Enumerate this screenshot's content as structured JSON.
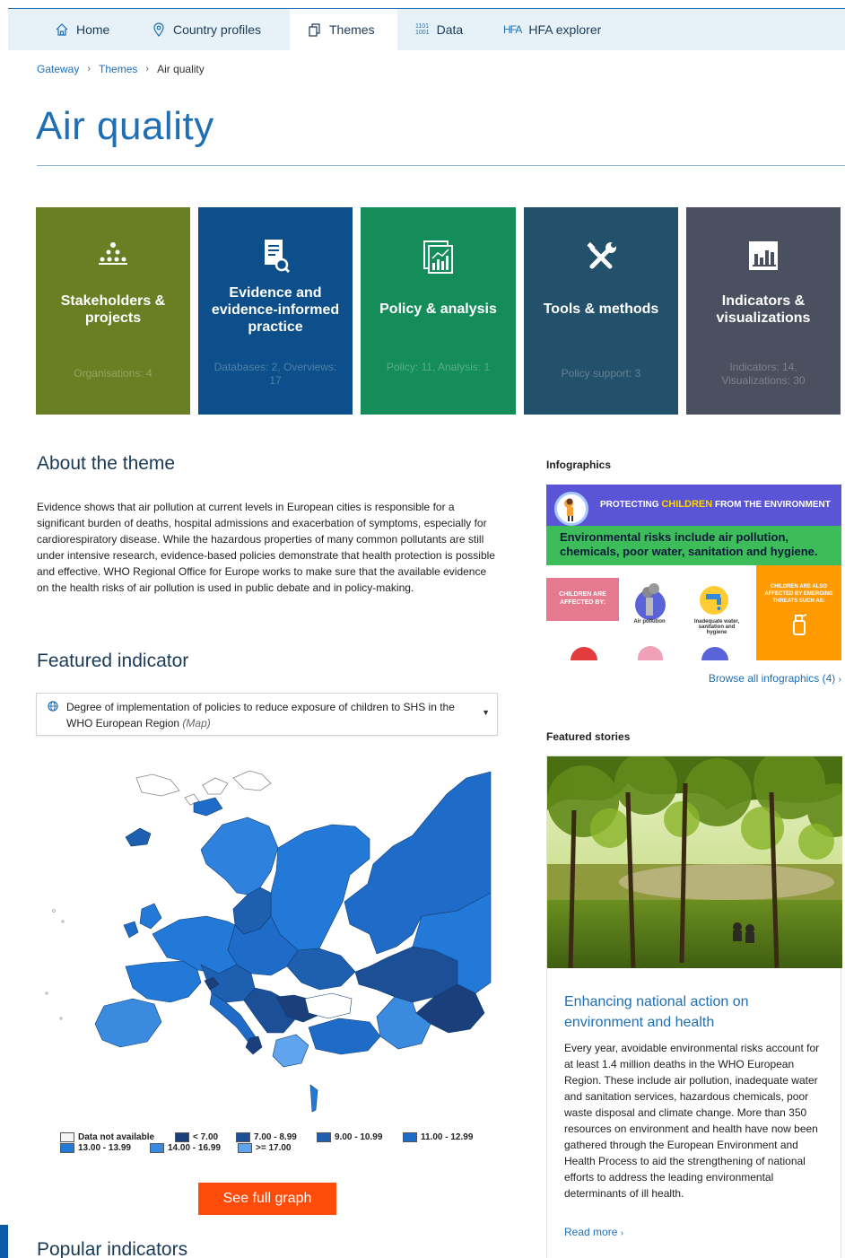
{
  "nav": {
    "items": [
      {
        "label": "Home",
        "icon": "home-icon"
      },
      {
        "label": "Country profiles",
        "icon": "location-pin-icon"
      },
      {
        "label": "Themes",
        "icon": "copy-pages-icon",
        "active": true
      },
      {
        "label": "Data",
        "icon": "binary-data-icon",
        "icon_text": "1101\n1001"
      },
      {
        "label": "HFA explorer",
        "icon": "hfa-icon",
        "icon_text": "HFA"
      }
    ]
  },
  "breadcrumb": [
    "Gateway",
    "Themes",
    "Air quality"
  ],
  "page_title": "Air quality",
  "tiles": [
    {
      "label": "Stakeholders & projects",
      "sub": "Organisations: 4",
      "icon": "people-network-icon",
      "color": "#6a7f24"
    },
    {
      "label": "Evidence and evidence-informed practice",
      "sub": "Databases: 2, Overviews: 17",
      "icon": "document-search-icon",
      "color": "#0c4f8a"
    },
    {
      "label": "Policy & analysis",
      "sub": "Policy: 11, Analysis: 1",
      "icon": "chart-report-icon",
      "color": "#158d5a"
    },
    {
      "label": "Tools & methods",
      "sub": "Policy support: 3",
      "icon": "tools-icon",
      "color": "#23516b"
    },
    {
      "label": "Indicators & visualizations",
      "sub": "Indicators: 14, Visualizations: 30",
      "icon": "bar-chart-icon",
      "color": "#4a5060"
    }
  ],
  "about": {
    "heading": "About the theme",
    "text": "Evidence shows that air pollution at current levels in European cities is responsible for a significant burden of deaths, hospital admissions and exacerbation of symptoms, especially for cardiorespiratory disease. While the hazardous properties of many common pollutants are still under intensive research, evidence-based policies demonstrate that health protection is possible and effective. WHO Regional Office for Europe works to make sure that the available evidence on the health risks of air pollution is used in public debate and in policy-making."
  },
  "featured_indicator": {
    "heading": "Featured indicator",
    "selected": "Degree of implementation of policies to reduce exposure of children to SHS in the WHO European Region",
    "selected_type": "(Map)",
    "legend": [
      {
        "label": "Data not available",
        "color": "#f5f5f5"
      },
      {
        "label": "< 7.00",
        "color": "#1a3f7a"
      },
      {
        "label": "7.00 - 8.99",
        "color": "#1d4f96"
      },
      {
        "label": "9.00 - 10.99",
        "color": "#1e5fb0"
      },
      {
        "label": "11.00 - 12.99",
        "color": "#1f6cc8"
      },
      {
        "label": "13.00 - 13.99",
        "color": "#2279d8"
      },
      {
        "label": "14.00 - 16.99",
        "color": "#3a8ae0"
      },
      {
        "label": ">= 17.00",
        "color": "#5fa4ec"
      }
    ],
    "button": "See full graph"
  },
  "popular_heading": "Popular indicators",
  "infographics": {
    "heading": "Infographics",
    "banner_pre": "PROTECTING",
    "banner_highlight": "CHILDREN",
    "banner_post": "FROM THE ENVIRONMENT",
    "green_text": "Environmental risks include air pollution, chemicals, poor water, sanitation and hygiene.",
    "pink_text": "CHILDREN ARE AFFECTED BY:",
    "cap_air": "Air pollution",
    "cap_water": "Inadequate water, sanitation and hygiene",
    "orange_text": "CHILDREN ARE ALSO AFFECTED BY EMERGING THREATS SUCH AS:",
    "browse": "Browse all infographics (4)"
  },
  "stories": {
    "heading": "Featured stories",
    "title": "Enhancing national action on environment and health",
    "text": "Every year, avoidable environmental risks account for at least 1.4 million deaths in the WHO European Region. These include air pollution, inadequate water and sanitation services, hazardous chemicals, poor waste disposal and climate change. More than 350 resources on environment and health have now been gathered through the European Environment and Health Process to aid the strengthening of national efforts to address the leading environmental determinants of ill health.",
    "read_more": "Read more"
  }
}
